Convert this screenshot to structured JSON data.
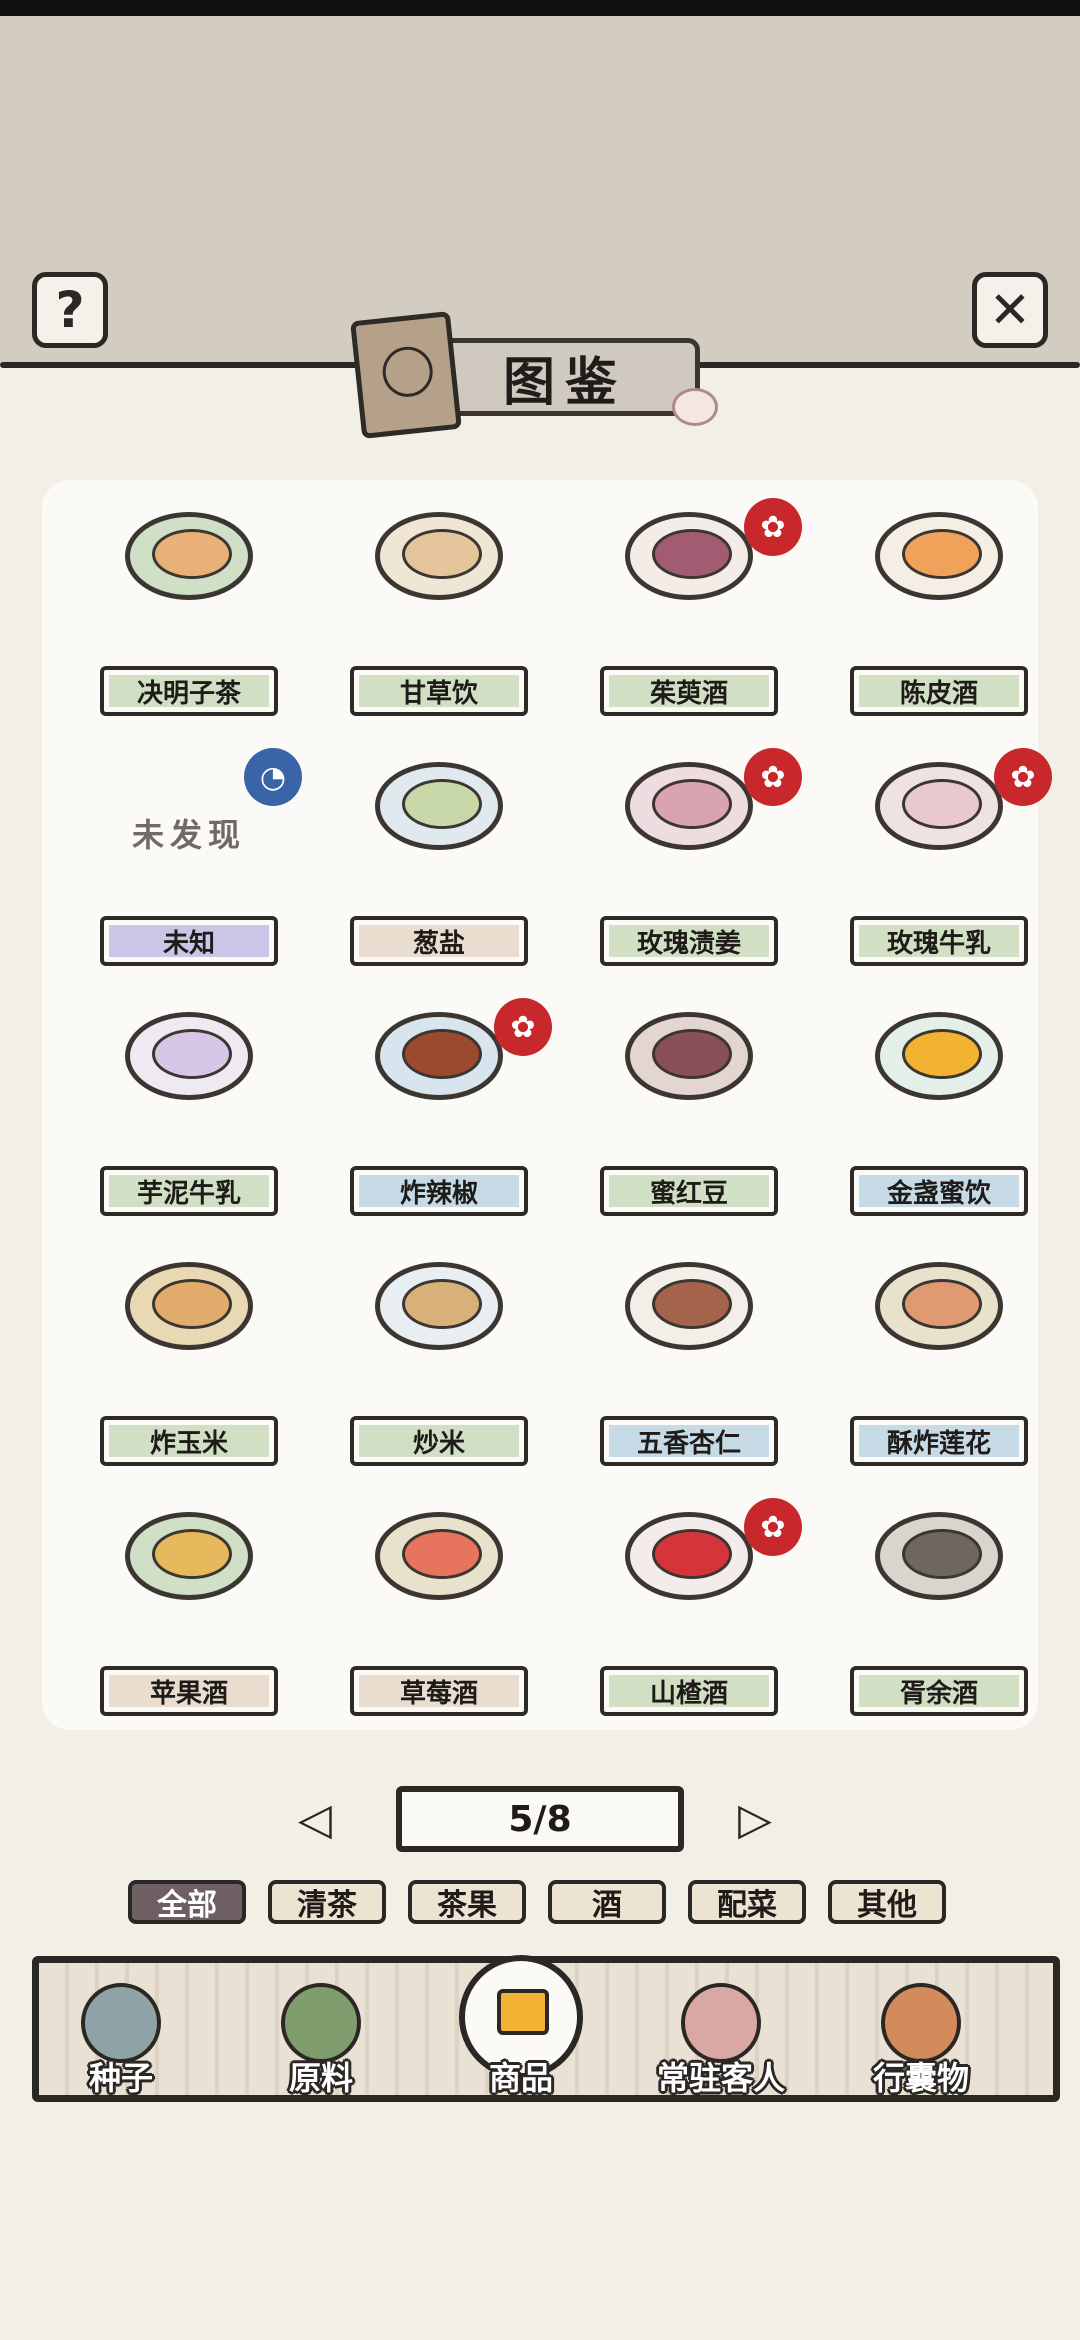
{
  "header": {
    "title": "图鉴",
    "help_icon": "?",
    "close_icon": "✕"
  },
  "grid": {
    "unfound_label": "未发现",
    "items": [
      {
        "name": "决明子茶",
        "plate": "green",
        "badge": "",
        "bowl": "#e7b178",
        "base": "#cfe0c6"
      },
      {
        "name": "甘草饮",
        "plate": "green",
        "badge": "",
        "bowl": "#e3c49b",
        "base": "#efe6d6"
      },
      {
        "name": "茱萸酒",
        "plate": "green",
        "badge": "new",
        "bowl": "#a25c72",
        "base": "#f3ece7"
      },
      {
        "name": "陈皮酒",
        "plate": "green",
        "badge": "",
        "bowl": "#f0a25a",
        "base": "#f5eee5"
      },
      {
        "name": "未知",
        "plate": "purple",
        "badge": "discover",
        "unknown": true
      },
      {
        "name": "葱盐",
        "plate": "beige",
        "badge": "",
        "bowl": "#c8d8a8",
        "base": "#dfe9ee"
      },
      {
        "name": "玫瑰渍姜",
        "plate": "green",
        "badge": "new",
        "bowl": "#d9a4b0",
        "base": "#eedde0"
      },
      {
        "name": "玫瑰牛乳",
        "plate": "green",
        "badge": "new",
        "bowl": "#e9c9cf",
        "base": "#efe3e2"
      },
      {
        "name": "芋泥牛乳",
        "plate": "green",
        "badge": "",
        "bowl": "#d7c6e6",
        "base": "#efeaf2"
      },
      {
        "name": "炸辣椒",
        "plate": "blue",
        "badge": "new",
        "bowl": "#9c4a2e",
        "base": "#d9e5ee"
      },
      {
        "name": "蜜红豆",
        "plate": "green",
        "badge": "",
        "bowl": "#8a5057",
        "base": "#e3d6d1"
      },
      {
        "name": "金盏蜜饮",
        "plate": "blue",
        "badge": "",
        "bowl": "#f2b232",
        "base": "#e5efe9"
      },
      {
        "name": "炸玉米",
        "plate": "green",
        "badge": "",
        "bowl": "#e2ad6c",
        "base": "#e9d8b4"
      },
      {
        "name": "炒米",
        "plate": "green",
        "badge": "",
        "bowl": "#d7b07a",
        "base": "#e8eef1"
      },
      {
        "name": "五香杏仁",
        "plate": "blue",
        "badge": "",
        "bowl": "#a4634b",
        "base": "#f4eee8"
      },
      {
        "name": "酥炸莲花",
        "plate": "blue",
        "badge": "",
        "bowl": "#e09a72",
        "base": "#e8e2cd"
      },
      {
        "name": "苹果酒",
        "plate": "beige",
        "badge": "",
        "bowl": "#e6b95c",
        "base": "#cfe0c6"
      },
      {
        "name": "草莓酒",
        "plate": "beige",
        "badge": "",
        "bowl": "#e7745c",
        "base": "#e8e2cd"
      },
      {
        "name": "山楂酒",
        "plate": "green",
        "badge": "new",
        "bowl": "#d6343b",
        "base": "#f4ecea"
      },
      {
        "name": "胥余酒",
        "plate": "green",
        "badge": "",
        "bowl": "#6e6760",
        "base": "#d9d4cc"
      }
    ]
  },
  "badge_glyphs": {
    "new": "✿",
    "discover": "◔"
  },
  "pager": {
    "text": "5/8",
    "prev": "◁",
    "next": "▷"
  },
  "filters": [
    {
      "label": "全部",
      "active": true
    },
    {
      "label": "清茶",
      "active": false
    },
    {
      "label": "茶果",
      "active": false
    },
    {
      "label": "酒",
      "active": false
    },
    {
      "label": "配菜",
      "active": false
    },
    {
      "label": "其他",
      "active": false
    }
  ],
  "nav": [
    {
      "label": "种子",
      "icon_color": "#8fa3a6",
      "active": false
    },
    {
      "label": "原料",
      "icon_color": "#7f9d6d",
      "active": false
    },
    {
      "label": "商品",
      "icon_color": "#f2b233",
      "active": true
    },
    {
      "label": "常驻客人",
      "icon_color": "#d9a8a4",
      "active": false
    },
    {
      "label": "行囊物",
      "icon_color": "#d48b5c",
      "active": false
    }
  ]
}
